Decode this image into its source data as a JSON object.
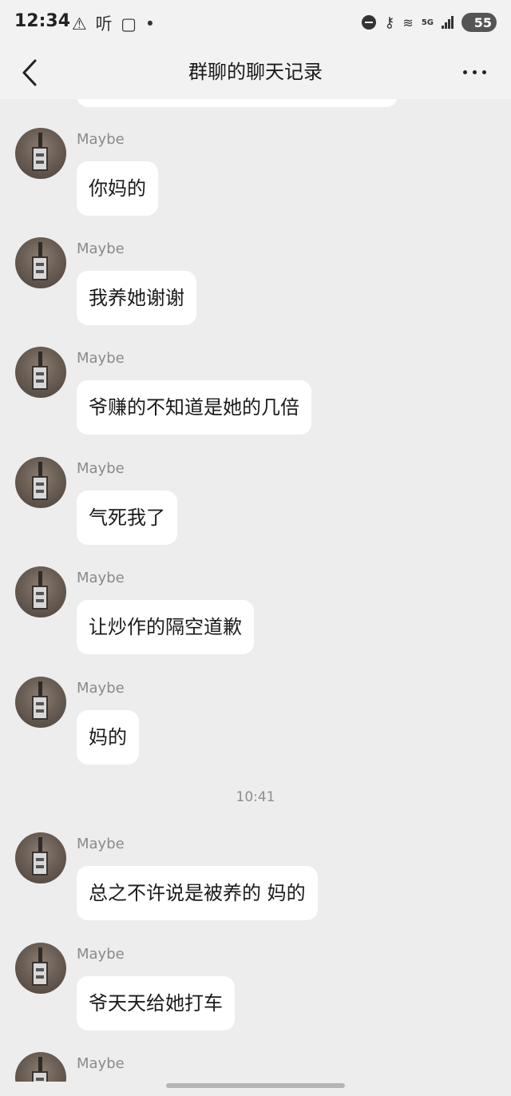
{
  "status_bar": {
    "time": "12:34",
    "left_icons": "⚠ 听 ▢ •",
    "signal_label": "5G",
    "battery": "55"
  },
  "nav": {
    "title": "群聊的聊天记录"
  },
  "timestamp": "10:41",
  "messages": [
    {
      "sender": "Maybe",
      "text": "你妈的"
    },
    {
      "sender": "Maybe",
      "text": "我养她谢谢"
    },
    {
      "sender": "Maybe",
      "text": "爷赚的不知道是她的几倍"
    },
    {
      "sender": "Maybe",
      "text": "气死我了"
    },
    {
      "sender": "Maybe",
      "text": "让炒作的隔空道歉"
    },
    {
      "sender": "Maybe",
      "text": "妈的"
    },
    {
      "sender": "Maybe",
      "text": "总之不许说是被养的 妈的"
    },
    {
      "sender": "Maybe",
      "text": "爷天天给她打车"
    },
    {
      "sender": "Maybe",
      "text": ""
    }
  ],
  "colors": {
    "background": "#ededed",
    "bubble": "#ffffff",
    "sender_name": "#8a8a8a"
  }
}
